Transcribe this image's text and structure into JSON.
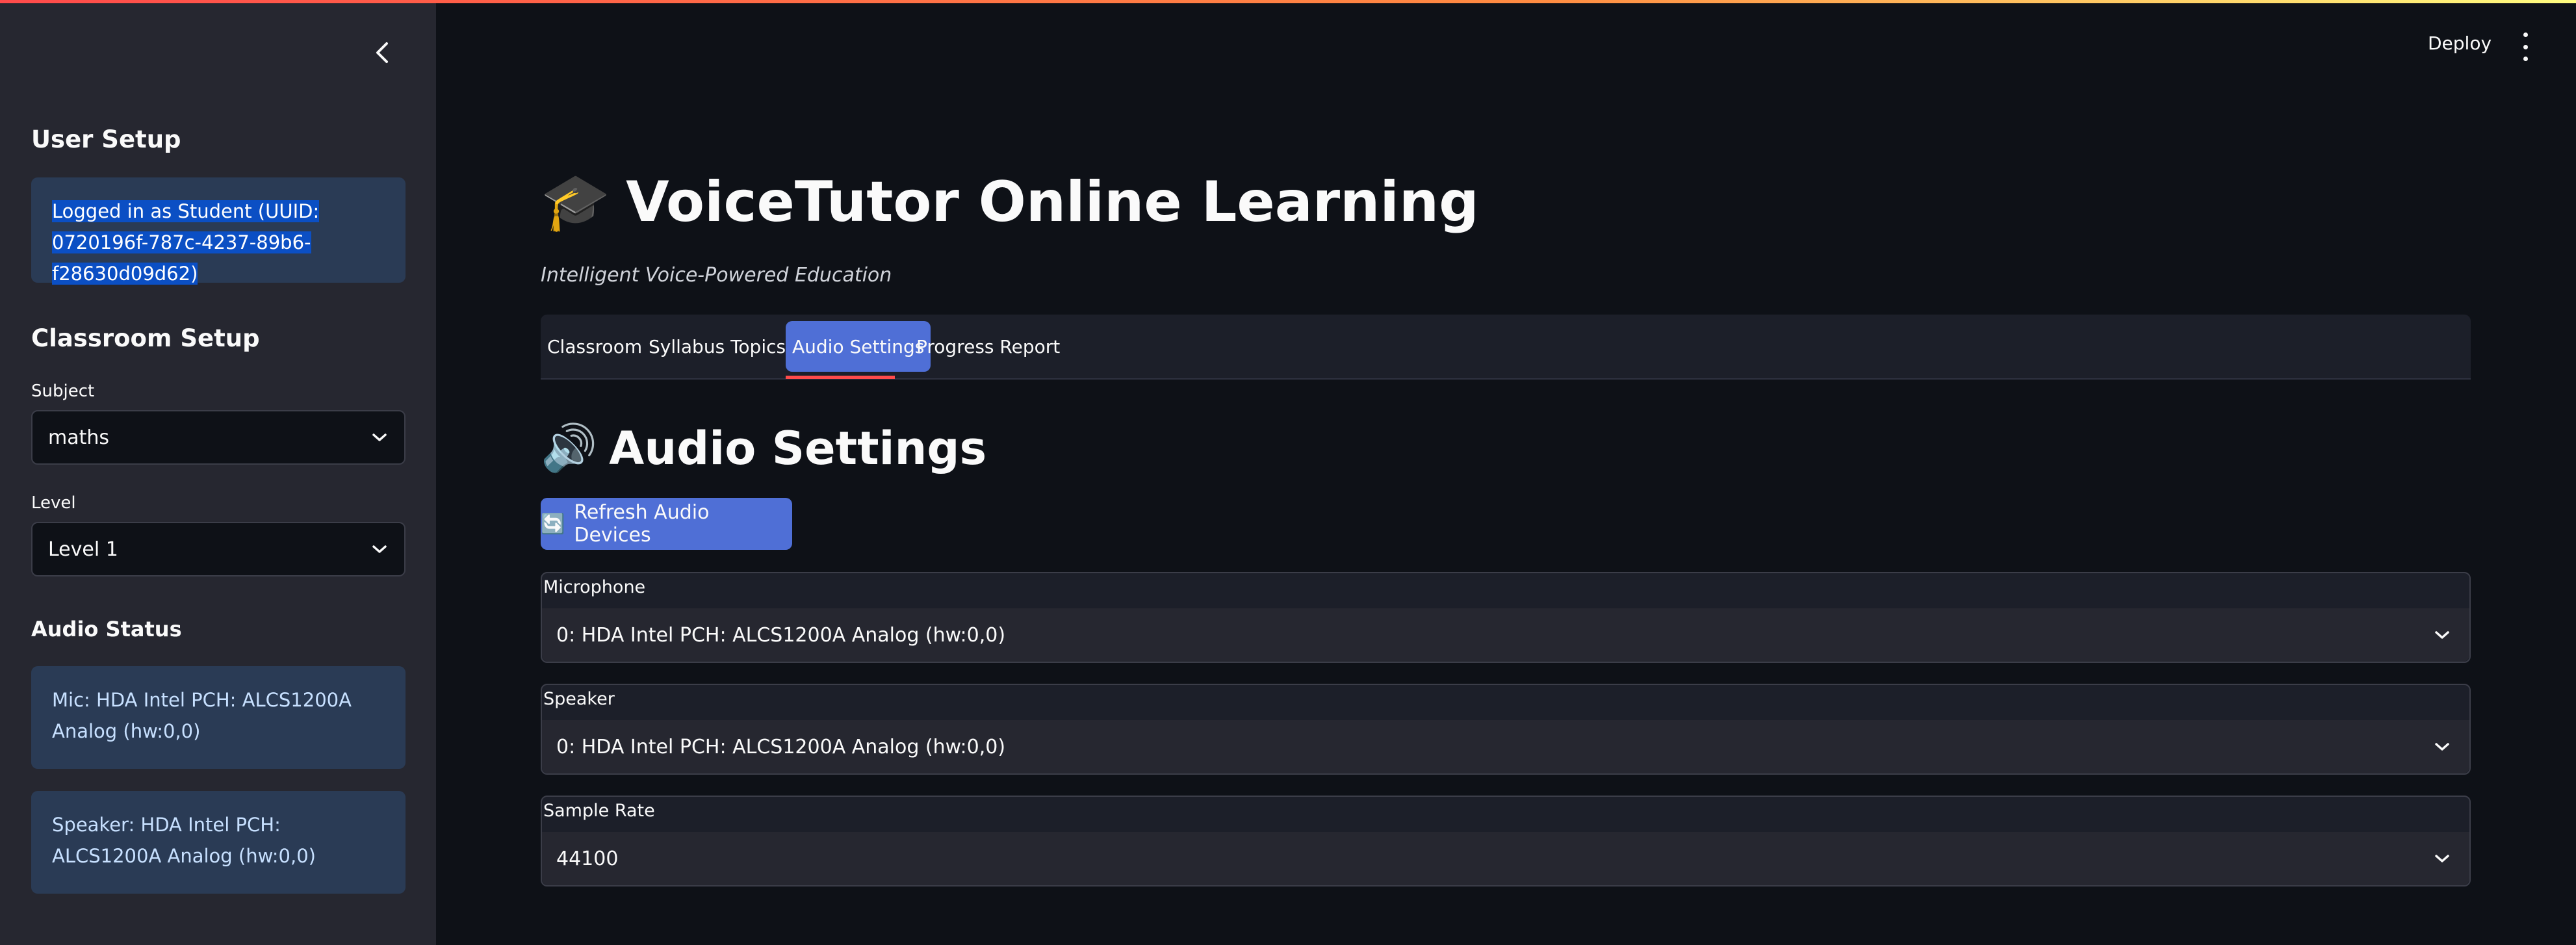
{
  "sidebar": {
    "user_setup_heading": "User Setup",
    "login_info": "Logged in as Student (UUID: 0720196f-787c-4237-89b6-f28630d09d62)",
    "classroom_heading": "Classroom Setup",
    "subject": {
      "label": "Subject",
      "value": "maths"
    },
    "level": {
      "label": "Level",
      "value": "Level 1"
    },
    "audio_status_heading": "Audio Status",
    "mic_status": "Mic: HDA Intel PCH: ALCS1200A Analog (hw:0,0)",
    "speaker_status": "Speaker: HDA Intel PCH: ALCS1200A Analog (hw:0,0)"
  },
  "header": {
    "deploy_label": "Deploy"
  },
  "main": {
    "title_icon": "🎓",
    "title": "VoiceTutor Online Learning",
    "subtitle": "Intelligent Voice-Powered Education",
    "tabs": [
      {
        "label": "Classroom",
        "active": false
      },
      {
        "label": "Syllabus Topics",
        "active": false
      },
      {
        "label": "Audio Settings",
        "active": true
      },
      {
        "label": "Progress Report",
        "active": false
      }
    ],
    "section_icon": "🔊",
    "section_title": "Audio Settings",
    "refresh_icon": "🔄",
    "refresh_label": "Refresh Audio Devices",
    "microphone": {
      "label": "Microphone",
      "value": "0: HDA Intel PCH: ALCS1200A Analog (hw:0,0)"
    },
    "speaker": {
      "label": "Speaker",
      "value": "0: HDA Intel PCH: ALCS1200A Analog (hw:0,0)"
    },
    "sample_rate": {
      "label": "Sample Rate",
      "value": "44100"
    }
  },
  "colors": {
    "accent": "#4f6fd6",
    "info_bg": "#2a3b55",
    "tab_underline": "#ff4b4b"
  }
}
